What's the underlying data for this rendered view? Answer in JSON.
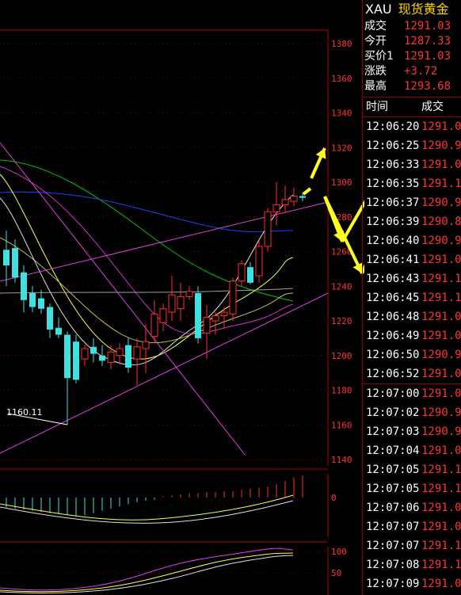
{
  "quote": {
    "symbol": "XAU",
    "name": "现货黄金",
    "rows": [
      {
        "label": "成交",
        "value": "1291.03"
      },
      {
        "label": "今开",
        "value": "1287.33"
      },
      {
        "label": "买价1",
        "value": "1291.03"
      },
      {
        "label": "涨跌",
        "value": "+3.72"
      },
      {
        "label": "最高",
        "value": "1293.68"
      }
    ]
  },
  "ticks": {
    "col_time": "时间",
    "col_price": "成交",
    "rows": [
      {
        "time": "12:06:20",
        "price": "1291.0"
      },
      {
        "time": "12:06:25",
        "price": "1290.9"
      },
      {
        "time": "12:06:33",
        "price": "1291.0"
      },
      {
        "time": "12:06:35",
        "price": "1291.1"
      },
      {
        "time": "12:06:37",
        "price": "1290.9"
      },
      {
        "time": "12:06:39",
        "price": "1290.8"
      },
      {
        "time": "12:06:40",
        "price": "1290.9"
      },
      {
        "time": "12:06:41",
        "price": "1291.0"
      },
      {
        "time": "12:06:43",
        "price": "1291.1"
      },
      {
        "time": "12:06:45",
        "price": "1291.1"
      },
      {
        "time": "12:06:48",
        "price": "1291.0"
      },
      {
        "time": "12:06:49",
        "price": "1291.0"
      },
      {
        "time": "12:06:50",
        "price": "1290.9"
      },
      {
        "time": "12:06:52",
        "price": "1291.0"
      },
      {
        "time": "12:07:00",
        "price": "1291.0"
      },
      {
        "time": "12:07:02",
        "price": "1290.9"
      },
      {
        "time": "12:07:03",
        "price": "1290.9"
      },
      {
        "time": "12:07:04",
        "price": "1291.0"
      },
      {
        "time": "12:07:05",
        "price": "1291.1"
      },
      {
        "time": "12:07:05",
        "price": "1291.1"
      },
      {
        "time": "12:07:06",
        "price": "1291.0"
      },
      {
        "time": "12:07:07",
        "price": "1291.0"
      },
      {
        "time": "12:07:07",
        "price": "1291.1"
      },
      {
        "time": "12:07:08",
        "price": "1291.1"
      },
      {
        "time": "12:07:09",
        "price": "1291.0"
      }
    ]
  },
  "chart_data": [
    {
      "type": "candlestick",
      "y_ticks": [
        "1380",
        "1360",
        "1340",
        "1320",
        "1300",
        "1280",
        "1260",
        "1240",
        "1220",
        "1200",
        "1180",
        "1160",
        "1140"
      ],
      "ylim": [
        1140,
        1380
      ],
      "low_annotation": "1160.11",
      "candles": [
        {
          "o": 1261,
          "h": 1272,
          "l": 1240,
          "c": 1252
        },
        {
          "o": 1262,
          "h": 1267,
          "l": 1242,
          "c": 1245
        },
        {
          "o": 1248,
          "h": 1252,
          "l": 1225,
          "c": 1232
        },
        {
          "o": 1236,
          "h": 1240,
          "l": 1225,
          "c": 1228
        },
        {
          "o": 1233,
          "h": 1238,
          "l": 1224,
          "c": 1227
        },
        {
          "o": 1228,
          "h": 1230,
          "l": 1210,
          "c": 1215
        },
        {
          "o": 1216,
          "h": 1222,
          "l": 1210,
          "c": 1212
        },
        {
          "o": 1212,
          "h": 1214,
          "l": 1160.11,
          "c": 1187
        },
        {
          "o": 1208,
          "h": 1212,
          "l": 1184,
          "c": 1186
        },
        {
          "o": 1198,
          "h": 1206,
          "l": 1194,
          "c": 1204
        },
        {
          "o": 1205,
          "h": 1210,
          "l": 1196,
          "c": 1201
        },
        {
          "o": 1200,
          "h": 1206,
          "l": 1194,
          "c": 1197
        },
        {
          "o": 1196,
          "h": 1206,
          "l": 1192,
          "c": 1202
        },
        {
          "o": 1200,
          "h": 1207,
          "l": 1195,
          "c": 1204
        },
        {
          "o": 1206,
          "h": 1210,
          "l": 1190,
          "c": 1193
        },
        {
          "o": 1198,
          "h": 1210,
          "l": 1183,
          "c": 1205
        },
        {
          "o": 1204,
          "h": 1218,
          "l": 1190,
          "c": 1208
        },
        {
          "o": 1211,
          "h": 1232,
          "l": 1208,
          "c": 1224
        },
        {
          "o": 1219,
          "h": 1230,
          "l": 1214,
          "c": 1227
        },
        {
          "o": 1225,
          "h": 1246,
          "l": 1220,
          "c": 1235
        },
        {
          "o": 1227,
          "h": 1242,
          "l": 1220,
          "c": 1234
        },
        {
          "o": 1234,
          "h": 1240,
          "l": 1232,
          "c": 1237
        },
        {
          "o": 1236,
          "h": 1240,
          "l": 1207,
          "c": 1210
        },
        {
          "o": 1213,
          "h": 1229,
          "l": 1198,
          "c": 1222
        },
        {
          "o": 1220,
          "h": 1225,
          "l": 1212,
          "c": 1223
        },
        {
          "o": 1223,
          "h": 1228,
          "l": 1216,
          "c": 1225
        },
        {
          "o": 1224,
          "h": 1245,
          "l": 1220,
          "c": 1243
        },
        {
          "o": 1243,
          "h": 1255,
          "l": 1240,
          "c": 1253
        },
        {
          "o": 1251,
          "h": 1254,
          "l": 1241,
          "c": 1242
        },
        {
          "o": 1246,
          "h": 1266,
          "l": 1242,
          "c": 1263
        },
        {
          "o": 1263,
          "h": 1285,
          "l": 1260,
          "c": 1283
        },
        {
          "o": 1283,
          "h": 1300,
          "l": 1275,
          "c": 1287
        },
        {
          "o": 1287,
          "h": 1298,
          "l": 1282,
          "c": 1290
        },
        {
          "o": 1289,
          "h": 1297,
          "l": 1286,
          "c": 1292
        },
        {
          "o": 1292,
          "h": 1294,
          "l": 1289,
          "c": 1291
        }
      ]
    },
    {
      "type": "bar",
      "y_ticks": [
        "0"
      ],
      "values": [
        -0.9,
        -1,
        -1.1,
        -1.2,
        -1.3,
        -1.4,
        -1.5,
        -1.6,
        -1.7,
        -1.6,
        -1.4,
        -1.2,
        -1.0,
        -0.8,
        -0.6,
        -0.4,
        -0.3,
        -0.2,
        0.1,
        0.2,
        0.3,
        0.4,
        0.4,
        0.5,
        0.5,
        0.6,
        0.6,
        0.7,
        0.8,
        0.9,
        1.0,
        1.2,
        1.5,
        1.8,
        2.0
      ]
    },
    {
      "type": "line",
      "y_ticks": [
        "100",
        "50"
      ]
    }
  ]
}
